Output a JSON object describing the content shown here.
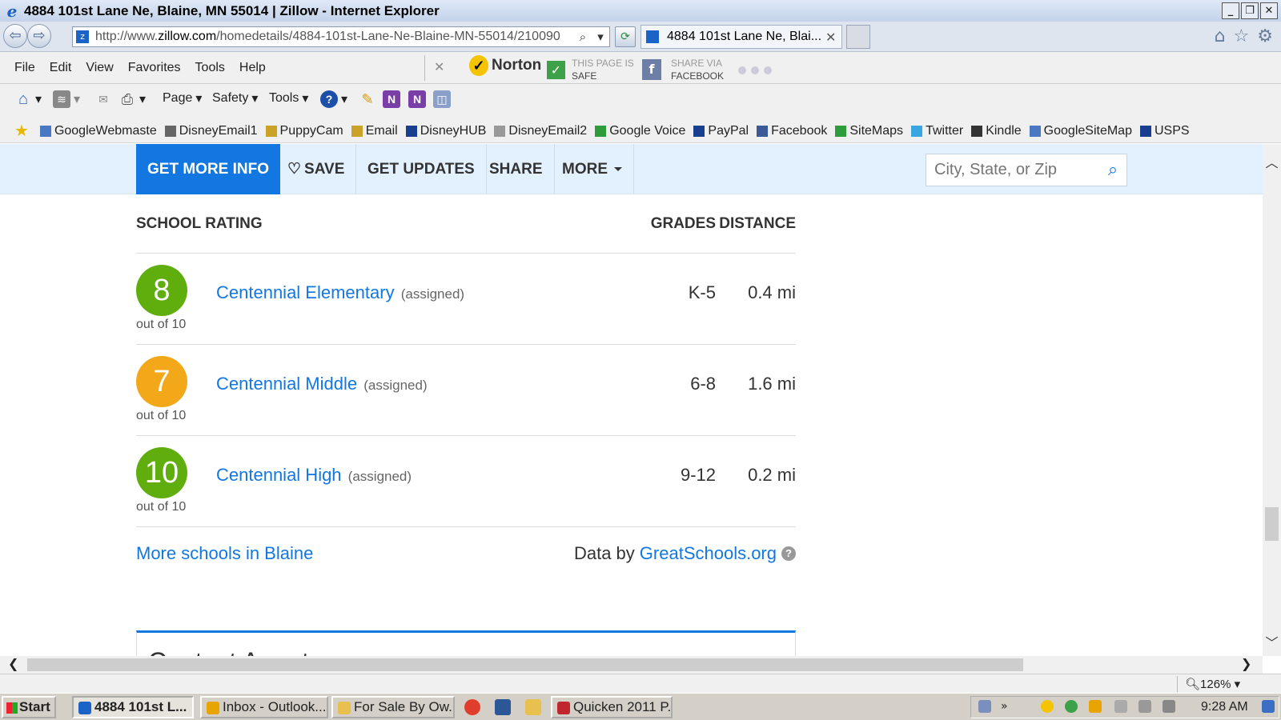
{
  "window": {
    "title": "4884 101st Lane Ne, Blaine, MN 55014 | Zillow - Internet Explorer"
  },
  "address_bar": {
    "url_prefix": "http://www.",
    "url_domain": "zillow.com",
    "url_path": "/homedetails/4884-101st-Lane-Ne-Blaine-MN-55014/210090"
  },
  "tab": {
    "title": "4884 101st Lane Ne, Blai..."
  },
  "menu": [
    "File",
    "Edit",
    "View",
    "Favorites",
    "Tools",
    "Help"
  ],
  "norton": {
    "brand": "Norton",
    "safe_line1": "THIS PAGE IS",
    "safe_line2": "SAFE",
    "share_line1": "SHARE VIA",
    "share_line2": "FACEBOOK"
  },
  "commandbar": {
    "page": "Page",
    "safety": "Safety",
    "tools": "Tools"
  },
  "favorites": [
    {
      "label": "GoogleWebmaste",
      "color": "#4a78c2"
    },
    {
      "label": "DisneyEmail1",
      "color": "#666666"
    },
    {
      "label": "PuppyCam",
      "color": "#c9a227"
    },
    {
      "label": "Email",
      "color": "#c9a227"
    },
    {
      "label": "DisneyHUB",
      "color": "#1b3f8f"
    },
    {
      "label": "DisneyEmail2",
      "color": "#999999"
    },
    {
      "label": "Google Voice",
      "color": "#2e9b3c"
    },
    {
      "label": "PayPal",
      "color": "#1b3f8f"
    },
    {
      "label": "Facebook",
      "color": "#3b5998"
    },
    {
      "label": "SiteMaps",
      "color": "#2e9b3c"
    },
    {
      "label": "Twitter",
      "color": "#3aa5e0"
    },
    {
      "label": "Kindle",
      "color": "#333333"
    },
    {
      "label": "GoogleSiteMap",
      "color": "#4a78c2"
    },
    {
      "label": "USPS",
      "color": "#1b3f8f"
    }
  ],
  "zillow_bar": {
    "get_more_info": "GET MORE INFO",
    "save": "SAVE",
    "get_updates": "GET UPDATES",
    "share": "SHARE",
    "more": "MORE",
    "search_placeholder": "City, State, or Zip"
  },
  "schools": {
    "header": {
      "rating": "SCHOOL RATING",
      "grades": "GRADES",
      "distance": "DISTANCE"
    },
    "rows": [
      {
        "rating": "8",
        "out_of": "out of 10",
        "name": "Centennial Elementary",
        "tag": "(assigned)",
        "grades": "K-5",
        "distance": "0.4 mi",
        "color": "#5fae0e"
      },
      {
        "rating": "7",
        "out_of": "out of 10",
        "name": "Centennial Middle",
        "tag": "(assigned)",
        "grades": "6-8",
        "distance": "1.6 mi",
        "color": "#f2a818"
      },
      {
        "rating": "10",
        "out_of": "out of 10",
        "name": "Centennial High",
        "tag": "(assigned)",
        "grades": "9-12",
        "distance": "0.2 mi",
        "color": "#5fae0e"
      }
    ],
    "more_link": "More schools in Blaine",
    "data_by": "Data by",
    "data_source": "GreatSchools.org"
  },
  "contact_heading": "Contact Agent",
  "status": {
    "zoom": "126%"
  },
  "taskbar": {
    "start": "Start",
    "buttons": [
      "4884 101st L...",
      "Inbox - Outlook...",
      "For Sale By Ow...",
      "Quicken 2011 P..."
    ],
    "clock": "9:28 AM"
  }
}
